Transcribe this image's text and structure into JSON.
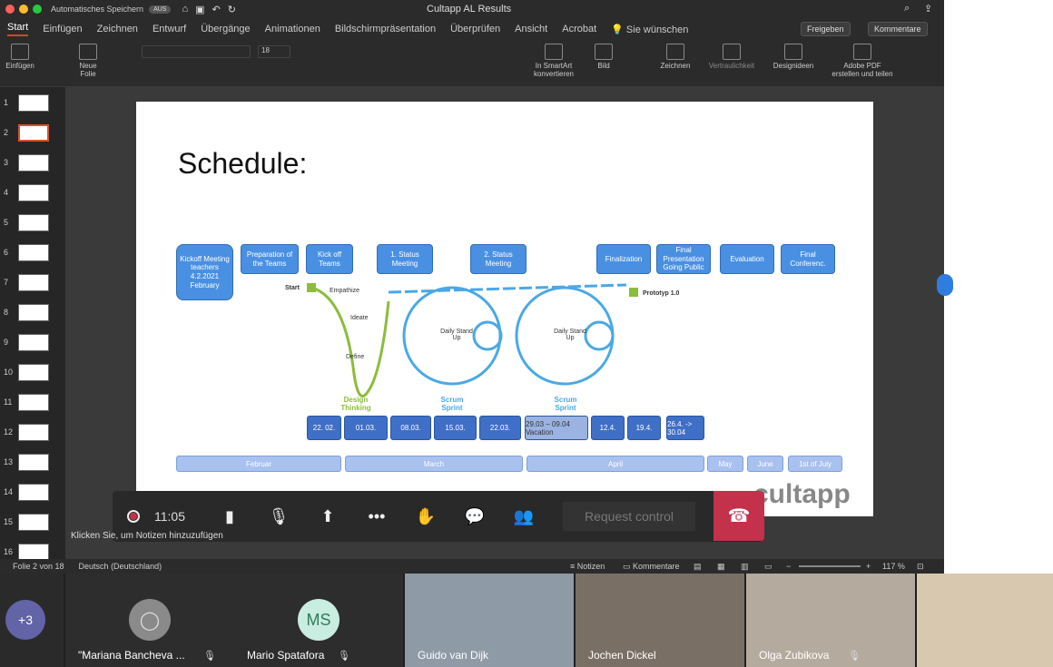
{
  "window": {
    "autosave_label": "Automatisches Speichern",
    "autosave_state": "AUS",
    "title": "Cultapp AL Results"
  },
  "ribbon_tabs": [
    "Start",
    "Einfügen",
    "Zeichnen",
    "Entwurf",
    "Übergänge",
    "Animationen",
    "Bildschirmpräsentation",
    "Überprüfen",
    "Ansicht",
    "Acrobat",
    "Sie wünschen"
  ],
  "ribbon_actions": {
    "share": "Freigeben",
    "comments": "Kommentare"
  },
  "ribbon_buttons": {
    "paste": "Einfügen",
    "new_slide_1": "Neue",
    "new_slide_2": "Folie",
    "font_size": "18",
    "smartart_1": "In SmartArt",
    "smartart_2": "konvertieren",
    "picture": "Bild",
    "draw": "Zeichnen",
    "confidentiality": "Vertraulichkeit",
    "designideas": "Designideen",
    "adobe_1": "Adobe PDF",
    "adobe_2": "erstellen und teilen"
  },
  "thumbnails": [
    "1",
    "2",
    "3",
    "4",
    "5",
    "6",
    "7",
    "8",
    "9",
    "10",
    "11",
    "12",
    "13",
    "14",
    "15",
    "16"
  ],
  "slide": {
    "title": "Schedule:",
    "top_boxes": [
      "Kickoff Meeting teachers 4.2.2021 February",
      "Preparation of the Teams",
      "Kick off Teams",
      "1. Status Meeting",
      "2. Status Meeting",
      "Finalization",
      "Final Presentation Going Public",
      "Evaluation",
      "Final Conferenc."
    ],
    "labels": {
      "start": "Start",
      "empathize": "Empathize",
      "ideate": "Ideate",
      "define": "Define",
      "prototype": "Prototyp 1.0",
      "daily1": "Daily Stand Up",
      "daily2": "Daily Stand Up",
      "design_thinking": "Design Thinking",
      "scrum1": "Scrum Sprint",
      "scrum2": "Scrum Sprint"
    },
    "dates": [
      "22. 02.",
      "01.03.",
      "08.03.",
      "15.03.",
      "22.03.",
      "29.03 – 09.04 Vacation",
      "12.4.",
      "19.4.",
      "26.4. -> 30.04"
    ],
    "months": [
      "Februar",
      "March",
      "April",
      "May",
      "June",
      "1st of July"
    ],
    "logo": "cultapp"
  },
  "call": {
    "time": "11:05",
    "request_control": "Request control"
  },
  "notes_placeholder": "Klicken Sie, um Notizen hinzuzufügen",
  "status": {
    "slide_of": "Folie 2 von 18",
    "language": "Deutsch (Deutschland)",
    "notes": "Notizen",
    "comments": "Kommentare",
    "zoom": "117 %"
  },
  "participants": {
    "more": "+3",
    "people": [
      "\"Mariana Bancheva ...",
      "Mario Spatafora",
      "Guido van Dijk",
      "Jochen Dickel",
      "Olga Zubikova"
    ],
    "ms_initials": "MS"
  },
  "colors": {
    "accent": "#d24726",
    "hangup": "#c4314b",
    "box": "#4a90e2"
  }
}
